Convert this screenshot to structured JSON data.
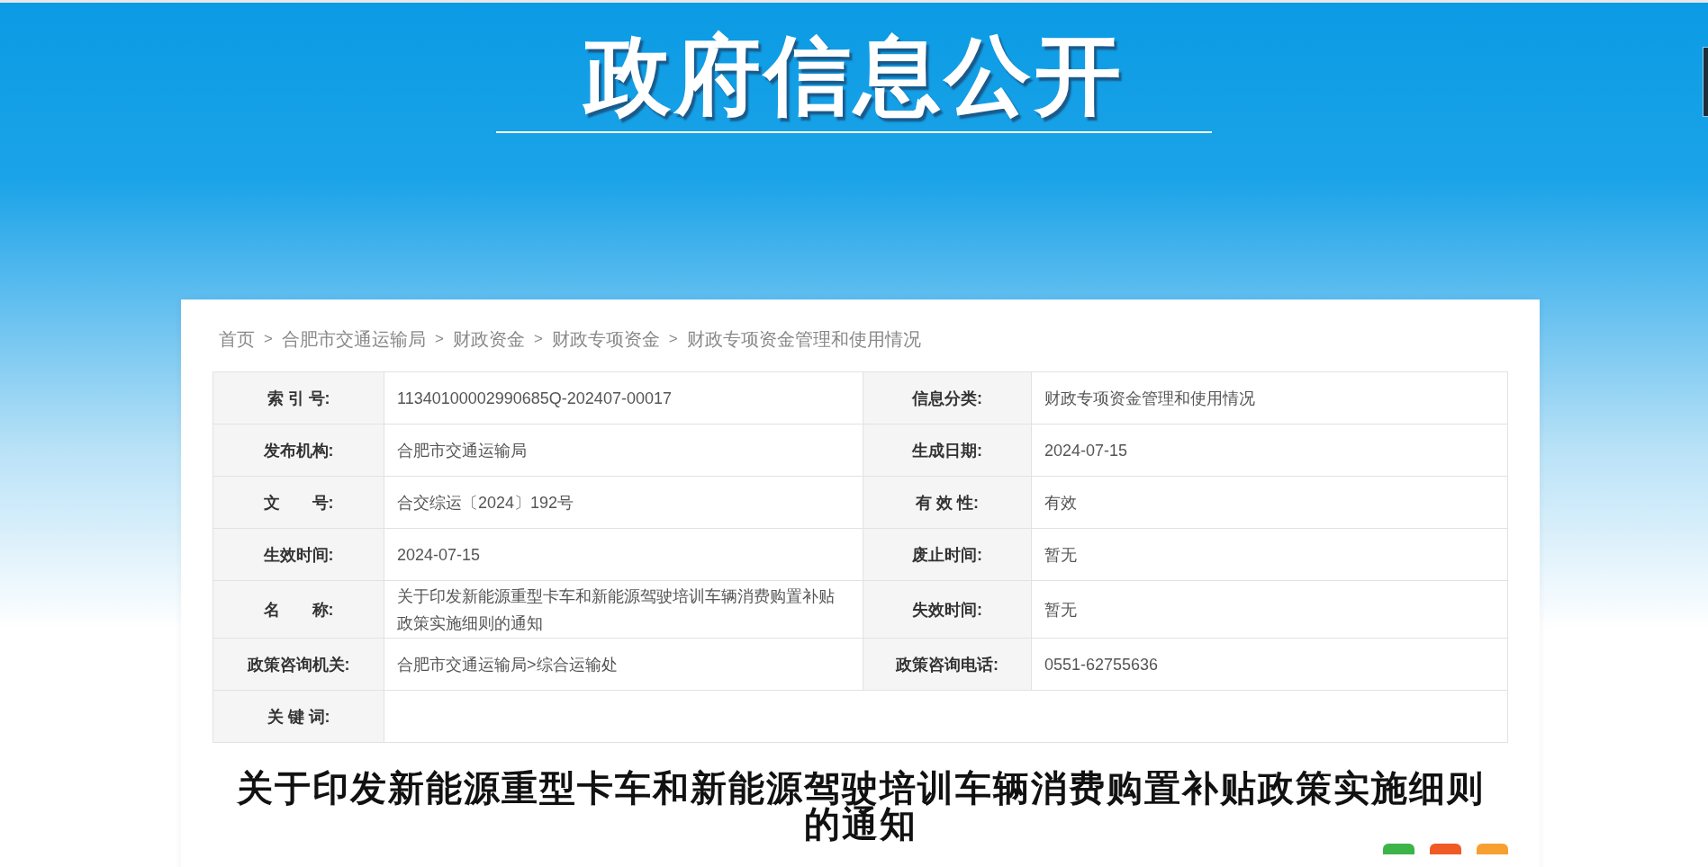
{
  "header": {
    "title": "政府信息公开"
  },
  "breadcrumb": [
    {
      "kind": "link",
      "text": "首页"
    },
    {
      "kind": "separator",
      "text": ">"
    },
    {
      "kind": "link",
      "text": "合肥市交通运输局"
    },
    {
      "kind": "separator",
      "text": ">"
    },
    {
      "kind": "link",
      "text": "财政资金"
    },
    {
      "kind": "separator",
      "text": ">"
    },
    {
      "kind": "link",
      "text": "财政专项资金"
    },
    {
      "kind": "separator",
      "text": ">"
    },
    {
      "kind": "link",
      "text": "财政专项资金管理和使用情况"
    }
  ],
  "info_table": {
    "rows": [
      [
        {
          "label": "索 引 号:",
          "value": "11340100002990685Q-202407-00017"
        },
        {
          "label": "信息分类:",
          "value": "财政专项资金管理和使用情况"
        }
      ],
      [
        {
          "label": "发布机构:",
          "value": "合肥市交通运输局"
        },
        {
          "label": "生成日期:",
          "value": "2024-07-15"
        }
      ],
      [
        {
          "label": "文　　号:",
          "value": "合交综运〔2024〕192号"
        },
        {
          "label": "有 效 性:",
          "value": "有效"
        }
      ],
      [
        {
          "label": "生效时间:",
          "value": "2024-07-15"
        },
        {
          "label": "废止时间:",
          "value": "暂无"
        }
      ],
      [
        {
          "label": "名　　称:",
          "value": "关于印发新能源重型卡车和新能源驾驶培训车辆消费购置补贴政策实施细则的通知"
        },
        {
          "label": "失效时间:",
          "value": "暂无"
        }
      ],
      [
        {
          "label": "政策咨询机关:",
          "value": "合肥市交通运输局>综合运输处"
        },
        {
          "label": "政策咨询电话:",
          "value": "0551-62755636"
        }
      ],
      [
        {
          "label": "关 键 词:"
        }
      ]
    ]
  },
  "article": {
    "title": "关于印发新能源重型卡车和新能源驾驶培训车辆消费购置补贴政策实施细则的通知"
  },
  "share_buttons": [
    {
      "color": "#3cb44a"
    },
    {
      "color": "#f05a24"
    },
    {
      "color": "#f7a030"
    }
  ]
}
